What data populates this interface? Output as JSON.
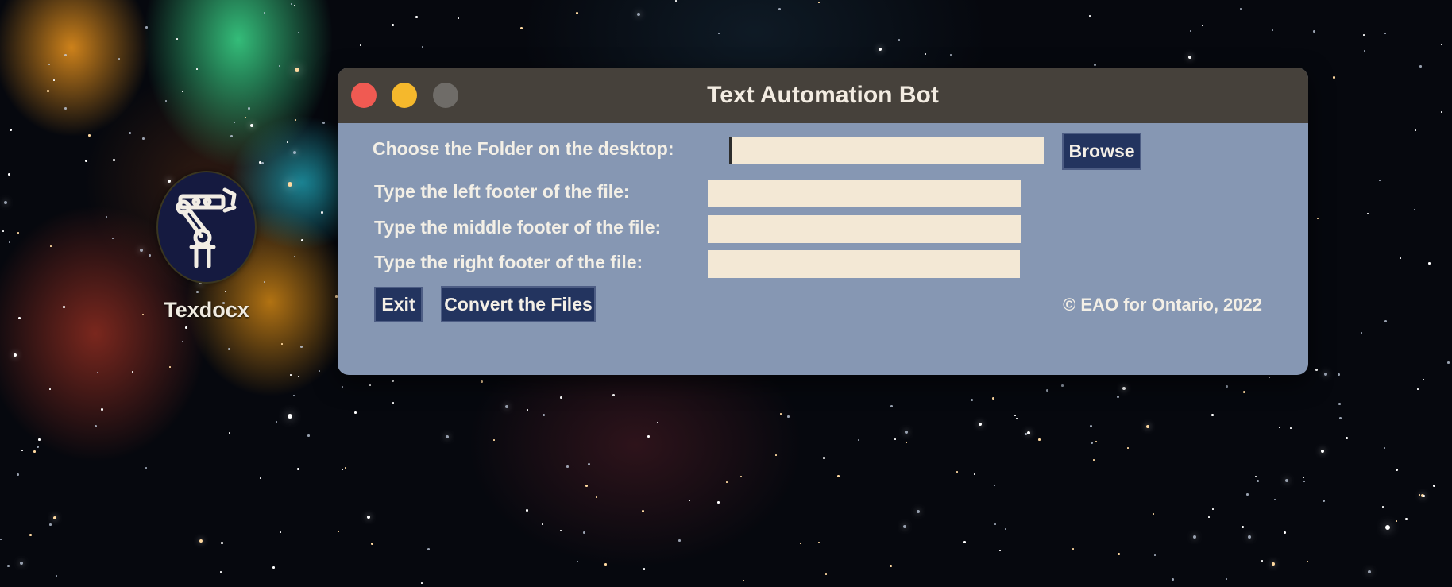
{
  "desktop": {
    "icons": [
      {
        "label": "Texdocx",
        "icon": "robot-arm-icon"
      }
    ]
  },
  "window": {
    "title": "Text Automation Bot",
    "controls": [
      "close",
      "minimize",
      "maximize"
    ],
    "colors": {
      "background": "#8697b3",
      "titlebar": "#46413b",
      "field": "#f3e8d5",
      "button": "#23345f"
    }
  },
  "form": {
    "folder": {
      "label": "Choose the Folder on the desktop:",
      "value": "",
      "browse_label": "Browse"
    },
    "left_footer": {
      "label": "Type the left footer of the file:",
      "value": ""
    },
    "middle_footer": {
      "label": "Type the middle footer of the file:",
      "value": ""
    },
    "right_footer": {
      "label": "Type the right footer of the file:",
      "value": ""
    }
  },
  "actions": {
    "exit_label": "Exit",
    "convert_label": "Convert the Files"
  },
  "footer": {
    "copyright": "© EAO for Ontario, 2022"
  }
}
